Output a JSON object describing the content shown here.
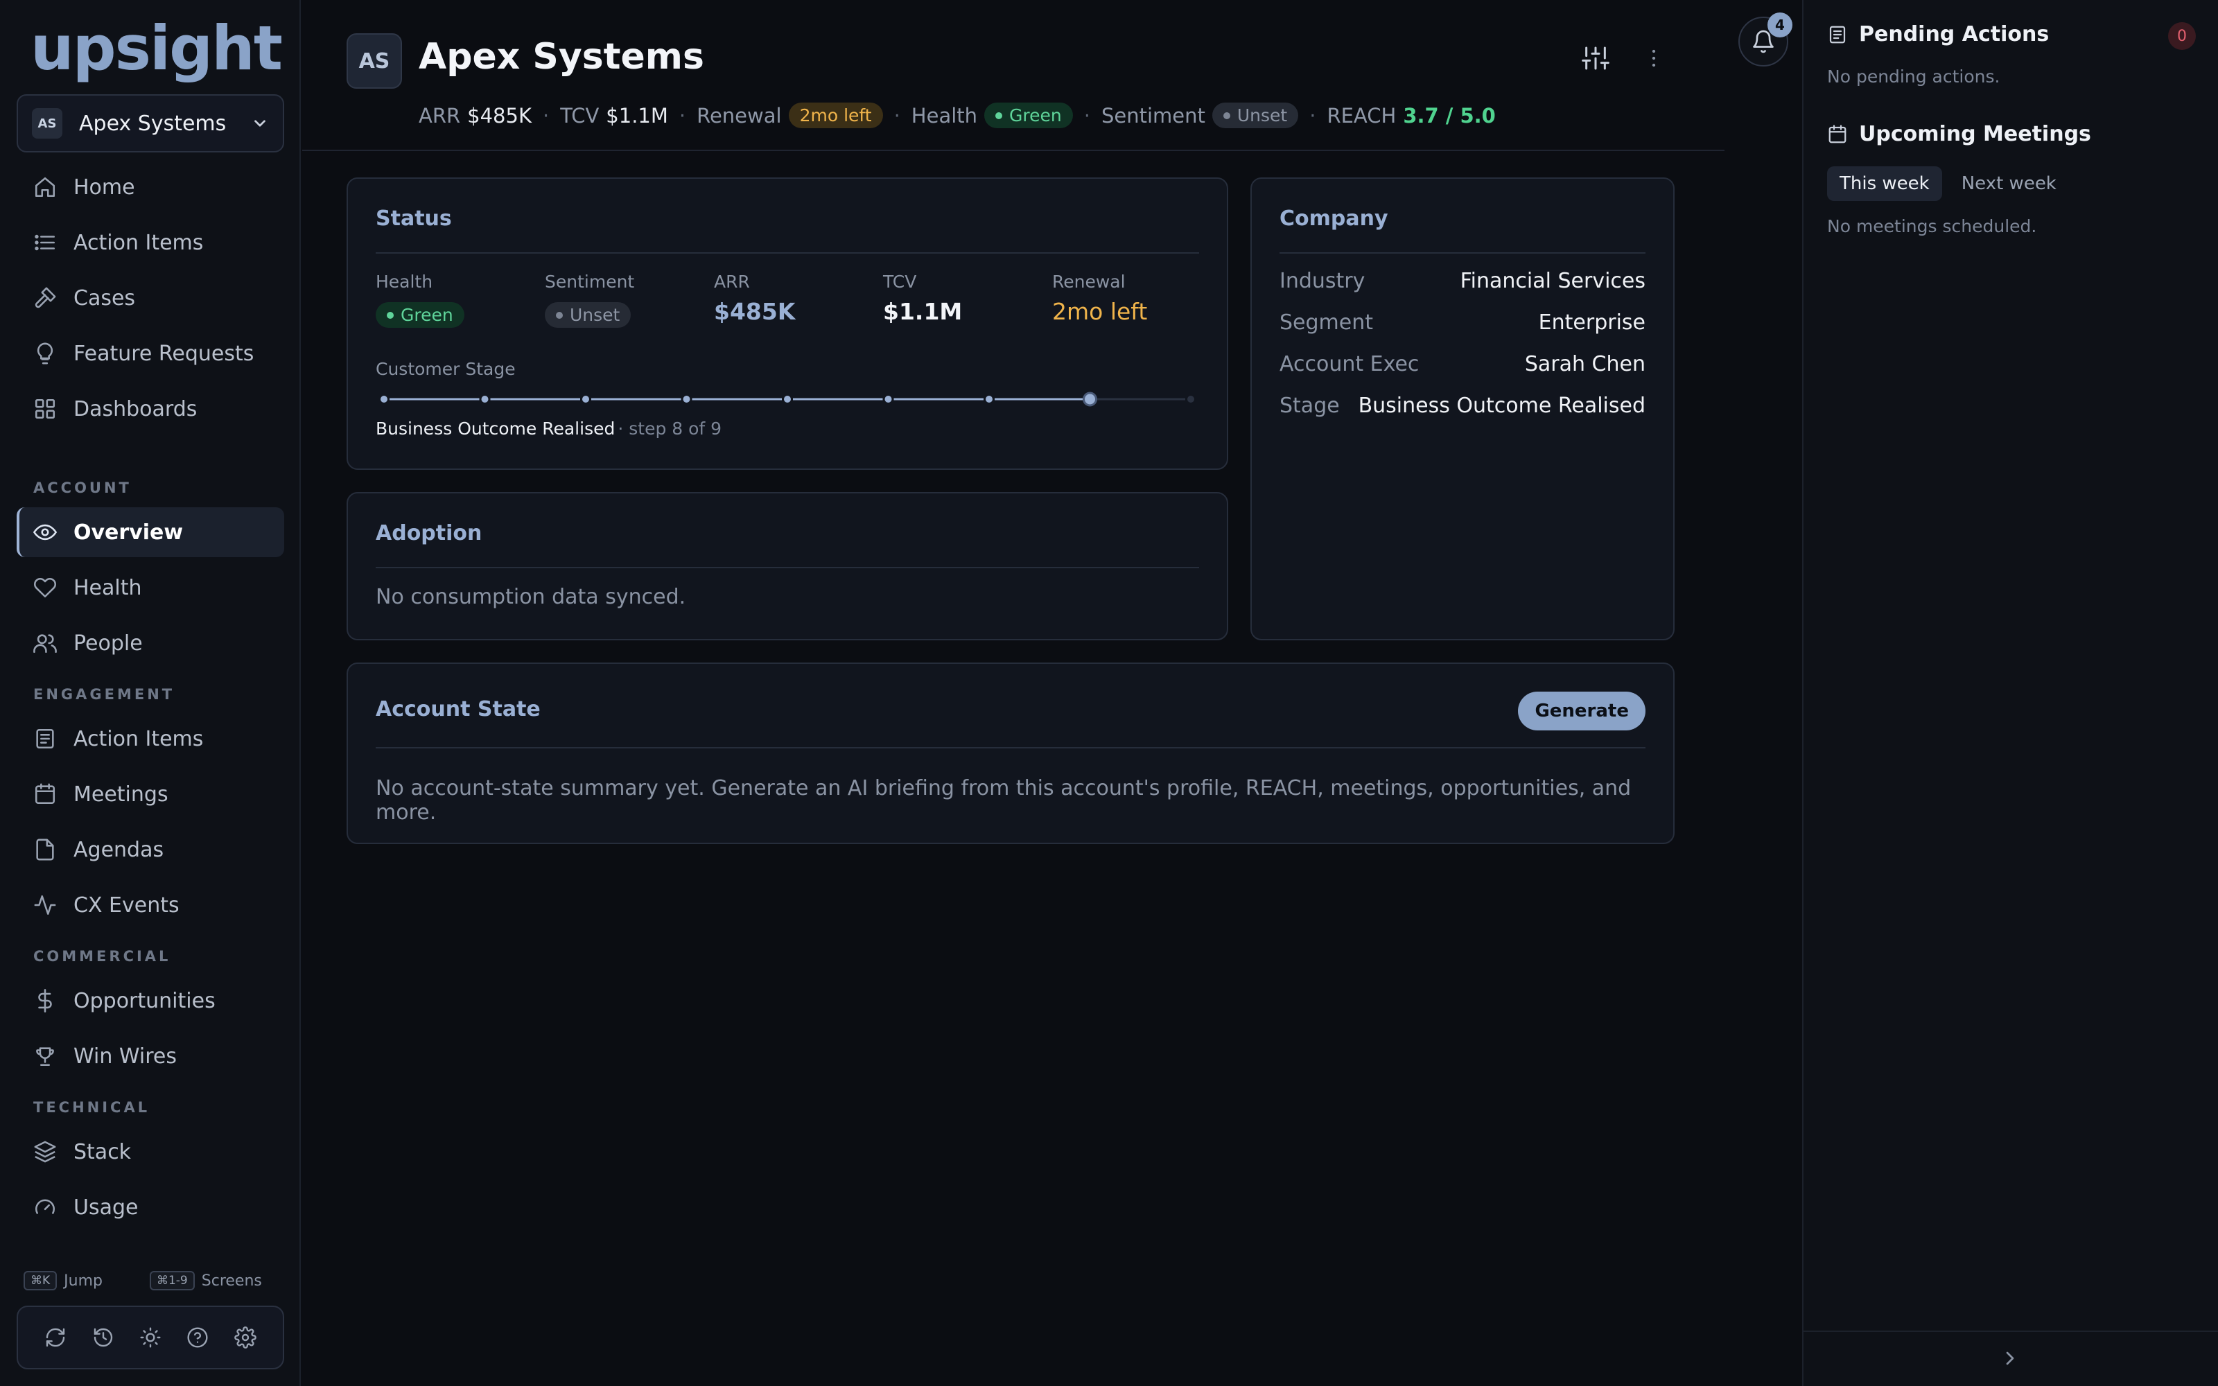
{
  "brand": {
    "name": "upsight"
  },
  "account_switcher": {
    "initials": "AS",
    "name": "Apex Systems"
  },
  "nav_primary": [
    {
      "label": "Home",
      "icon": "home-icon"
    },
    {
      "label": "Action Items",
      "icon": "list-icon"
    },
    {
      "label": "Cases",
      "icon": "hammer-icon"
    },
    {
      "label": "Feature Requests",
      "icon": "lightbulb-icon"
    },
    {
      "label": "Dashboards",
      "icon": "grid-icon"
    }
  ],
  "sections": {
    "account": "ACCOUNT",
    "engagement": "ENGAGEMENT",
    "commercial": "COMMERCIAL",
    "technical": "TECHNICAL"
  },
  "nav_account": [
    {
      "label": "Overview",
      "icon": "eye-icon",
      "active": true
    },
    {
      "label": "Health",
      "icon": "heart-icon"
    },
    {
      "label": "People",
      "icon": "users-icon"
    }
  ],
  "nav_engagement": [
    {
      "label": "Action Items",
      "icon": "clipboard-icon"
    },
    {
      "label": "Meetings",
      "icon": "calendar-icon"
    },
    {
      "label": "Agendas",
      "icon": "file-icon"
    },
    {
      "label": "CX Events",
      "icon": "activity-icon"
    }
  ],
  "nav_commercial": [
    {
      "label": "Opportunities",
      "icon": "dollar-icon"
    },
    {
      "label": "Win Wires",
      "icon": "trophy-icon"
    }
  ],
  "nav_technical": [
    {
      "label": "Stack",
      "icon": "layers-icon"
    },
    {
      "label": "Usage",
      "icon": "gauge-icon"
    }
  ],
  "shortcuts": {
    "jump_key": "⌘K",
    "jump_label": "Jump",
    "screens_key": "⌘1-9",
    "screens_label": "Screens"
  },
  "header": {
    "initials": "AS",
    "title": "Apex Systems",
    "arr_label": "ARR",
    "arr_value": "$485K",
    "tcv_label": "TCV",
    "tcv_value": "$1.1M",
    "renewal_label": "Renewal",
    "renewal_value": "2mo left",
    "health_label": "Health",
    "health_value": "Green",
    "sentiment_label": "Sentiment",
    "sentiment_value": "Unset",
    "reach_label": "REACH",
    "reach_value": "3.7 / 5.0",
    "notification_count": "4"
  },
  "status_card": {
    "title": "Status",
    "health_label": "Health",
    "health_value": "Green",
    "sentiment_label": "Sentiment",
    "sentiment_value": "Unset",
    "arr_label": "ARR",
    "arr_value": "$485K",
    "tcv_label": "TCV",
    "tcv_value": "$1.1M",
    "renewal_label": "Renewal",
    "renewal_value": "2mo left",
    "stage_label": "Customer Stage",
    "stage_name": "Business Outcome Realised",
    "stage_step": "· step 8 of 9",
    "stage_current": 8,
    "stage_total": 9
  },
  "company_card": {
    "title": "Company",
    "rows": [
      {
        "key": "Industry",
        "value": "Financial Services"
      },
      {
        "key": "Segment",
        "value": "Enterprise"
      },
      {
        "key": "Account Exec",
        "value": "Sarah Chen"
      },
      {
        "key": "Stage",
        "value": "Business Outcome Realised"
      }
    ]
  },
  "adoption_card": {
    "title": "Adoption",
    "empty": "No consumption data synced."
  },
  "account_state_card": {
    "title": "Account State",
    "button": "Generate",
    "empty": "No account-state summary yet. Generate an AI briefing from this account's profile, REACH, meetings, opportunities, and more."
  },
  "right_panel": {
    "pending_title": "Pending Actions",
    "pending_count": "0",
    "pending_empty": "No pending actions.",
    "meetings_title": "Upcoming Meetings",
    "tab_this_week": "This week",
    "tab_next_week": "Next week",
    "meetings_empty": "No meetings scheduled."
  },
  "colors": {
    "accent": "#8aa3c8",
    "green": "#5fd49a",
    "amber": "#f0b44b",
    "reach": "#50d38f"
  }
}
